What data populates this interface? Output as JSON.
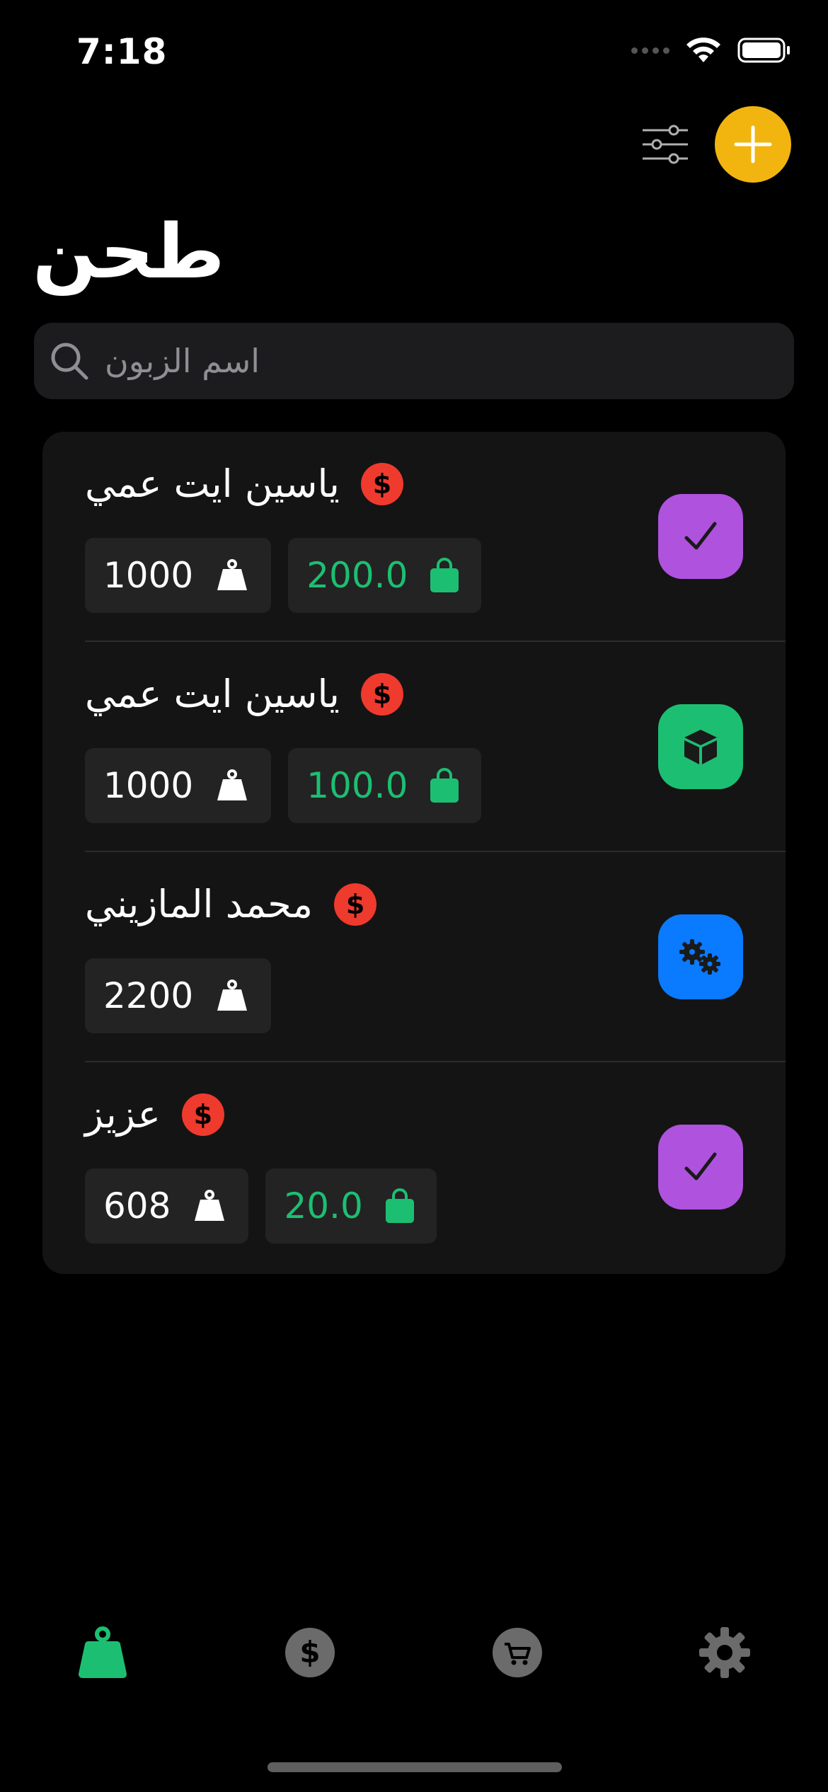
{
  "status_bar": {
    "time": "7:18"
  },
  "header": {
    "title": "طحن"
  },
  "search": {
    "placeholder": "اسم الزبون"
  },
  "currency_symbol": "$",
  "rows": [
    {
      "name": "ياسين ايت عمي",
      "weight": "1000",
      "amount": "200.0",
      "status": "done-check"
    },
    {
      "name": "ياسين ايت عمي",
      "weight": "1000",
      "amount": "100.0",
      "status": "package"
    },
    {
      "name": "محمد المازيني",
      "weight": "2200",
      "amount": null,
      "status": "processing-gears"
    },
    {
      "name": "عزيز",
      "weight": "608",
      "amount": "20.0",
      "status": "done-check"
    }
  ],
  "colors": {
    "accent_yellow": "#f2b50f",
    "green": "#1cbf72",
    "red_badge": "#ef3a2e",
    "purple": "#af52de",
    "blue": "#0a7aff"
  },
  "tabs": [
    {
      "icon": "weight-icon",
      "active": true
    },
    {
      "icon": "dollar-icon",
      "active": false
    },
    {
      "icon": "cart-icon",
      "active": false
    },
    {
      "icon": "gear-icon",
      "active": false
    }
  ]
}
